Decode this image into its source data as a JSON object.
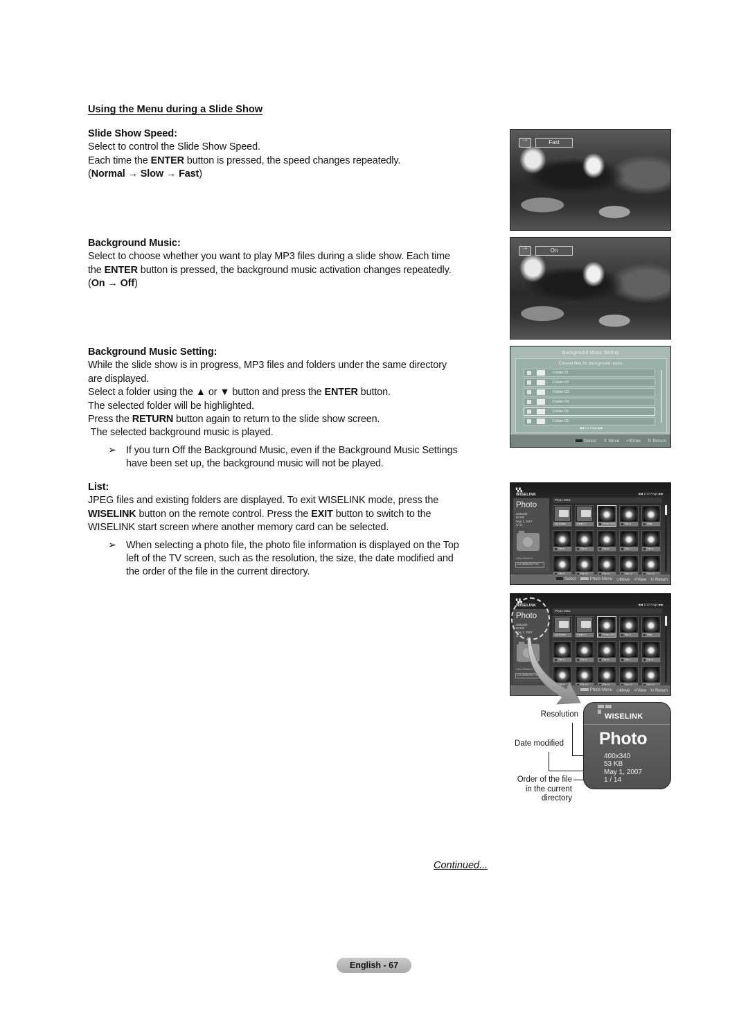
{
  "section": {
    "title": "Using the Menu during a Slide Show"
  },
  "speed": {
    "heading": "Slide Show Speed:",
    "line1": "Select to control the Slide Show Speed.",
    "line2_pre": "Each time the ",
    "line2_bold": "ENTER",
    "line2_post": " button is pressed, the speed changes repeatedly.",
    "seq_open": "(",
    "seq_1": "Normal",
    "seq_arrow": " → ",
    "seq_2": "Slow",
    "seq_3": "Fast",
    "seq_close": ")",
    "osd_label": "Fast"
  },
  "music": {
    "heading": "Background Music:",
    "line1": "Select to choose whether you want to play MP3 files during a slide show. Each time",
    "line2_pre": "the ",
    "line2_bold": "ENTER",
    "line2_post": " button is pressed, the background music activation changes repeatedly.",
    "seq_open": "(",
    "seq_1": "On",
    "seq_arrow": " → ",
    "seq_2": "Off",
    "seq_close": ")",
    "osd_label": "On"
  },
  "music_setting": {
    "heading": "Background Music Setting:",
    "line1": "While the slide show is in progress, MP3 files and folders under the same directory",
    "line2": "are displayed.",
    "line3_pre": "Select a folder using the ▲ or ▼ button and press the ",
    "line3_bold": "ENTER",
    "line3_post": " button.",
    "line4": "The selected folder will be highlighted.",
    "line5_pre": "Press the ",
    "line5_bold": "RETURN",
    "line5_post": " button again to return to the slide show screen.",
    "line6": " The selected background music is played.",
    "note_arrow": "➢",
    "note_line1": "If you turn Off the Background Music, even if the Background Music Settings",
    "note_line2": "have been set up, the background music will not be played.",
    "panel": {
      "title": "Background Music Setting",
      "subtitle": "Choose files for background music.",
      "folders": [
        "Folder 01",
        "Folder 02",
        "Folder 03",
        "Folder 04",
        "Folder 05",
        "Folder 06"
      ],
      "selected_index": 4,
      "page": "◀◀ 1/1 Page ▶▶",
      "footer": {
        "select": "Select",
        "move": "⇕ Move",
        "enter": "⏎Enter",
        "return": "↻ Return"
      }
    }
  },
  "list": {
    "heading": "List:",
    "line1": "JPEG files and existing folders are displayed. To exit WISELINK mode, press the",
    "line2_bold1": "WISELINK",
    "line2_mid": " button on the remote control. Press the ",
    "line2_bold2": "EXIT",
    "line2_post": " button to switch to the",
    "line3": "WISELINK start screen where another memory card can be selected.",
    "note_arrow": "➢",
    "note_line1": "When selecting a photo file, the photo file information is displayed on the Top",
    "note_line2": "left of the TV screen, such as the resolution, the size, the date modified and",
    "note_line3": "the order of the file in the current directory.",
    "screen": {
      "logo": "WISELINK",
      "pager": "◀◀ 1/10 Page ▶▶",
      "title": "Photo",
      "path": "Photo 0001",
      "info": [
        "400x340",
        "53 KB",
        "May 1, 2007",
        "1/ 14"
      ],
      "device": "CELLGDA2.0",
      "free": "215.08MB/256 Free",
      "tiles": [
        {
          "label": "Up Folder",
          "type": "folder"
        },
        {
          "label": "Folder 1",
          "type": "folder"
        },
        {
          "label": "Photo 0001",
          "type": "photo",
          "selected": true
        },
        {
          "label": "File 2",
          "type": "photo"
        },
        {
          "label": "Note",
          "type": "photo"
        },
        {
          "label": "File 6",
          "type": "photo"
        },
        {
          "label": "File 5",
          "type": "photo"
        },
        {
          "label": "File 6",
          "type": "photo"
        },
        {
          "label": "File 7",
          "type": "photo"
        },
        {
          "label": "File 8",
          "type": "photo"
        },
        {
          "label": "File 9",
          "type": "photo"
        },
        {
          "label": "File 10",
          "type": "photo"
        },
        {
          "label": "File 11",
          "type": "photo"
        },
        {
          "label": "File 12",
          "type": "photo"
        },
        {
          "label": "File 13",
          "type": "photo"
        }
      ],
      "footer": {
        "select": "Select",
        "menu": "Photo Menu",
        "move": "◇Move",
        "view": "⏎View",
        "return": "↻ Return"
      }
    }
  },
  "callout": {
    "logo": "WISELINK",
    "title": "Photo",
    "resolution": "400x340",
    "size": "53 KB",
    "date": "May 1, 2007",
    "order": "1 / 14",
    "label_resolution": "Resolution",
    "label_date": "Date modified",
    "label_order_1": "Order of the file",
    "label_order_2": "in the current",
    "label_order_3": "directory"
  },
  "footer": {
    "continued": "Continued...",
    "page": "English - 67"
  }
}
